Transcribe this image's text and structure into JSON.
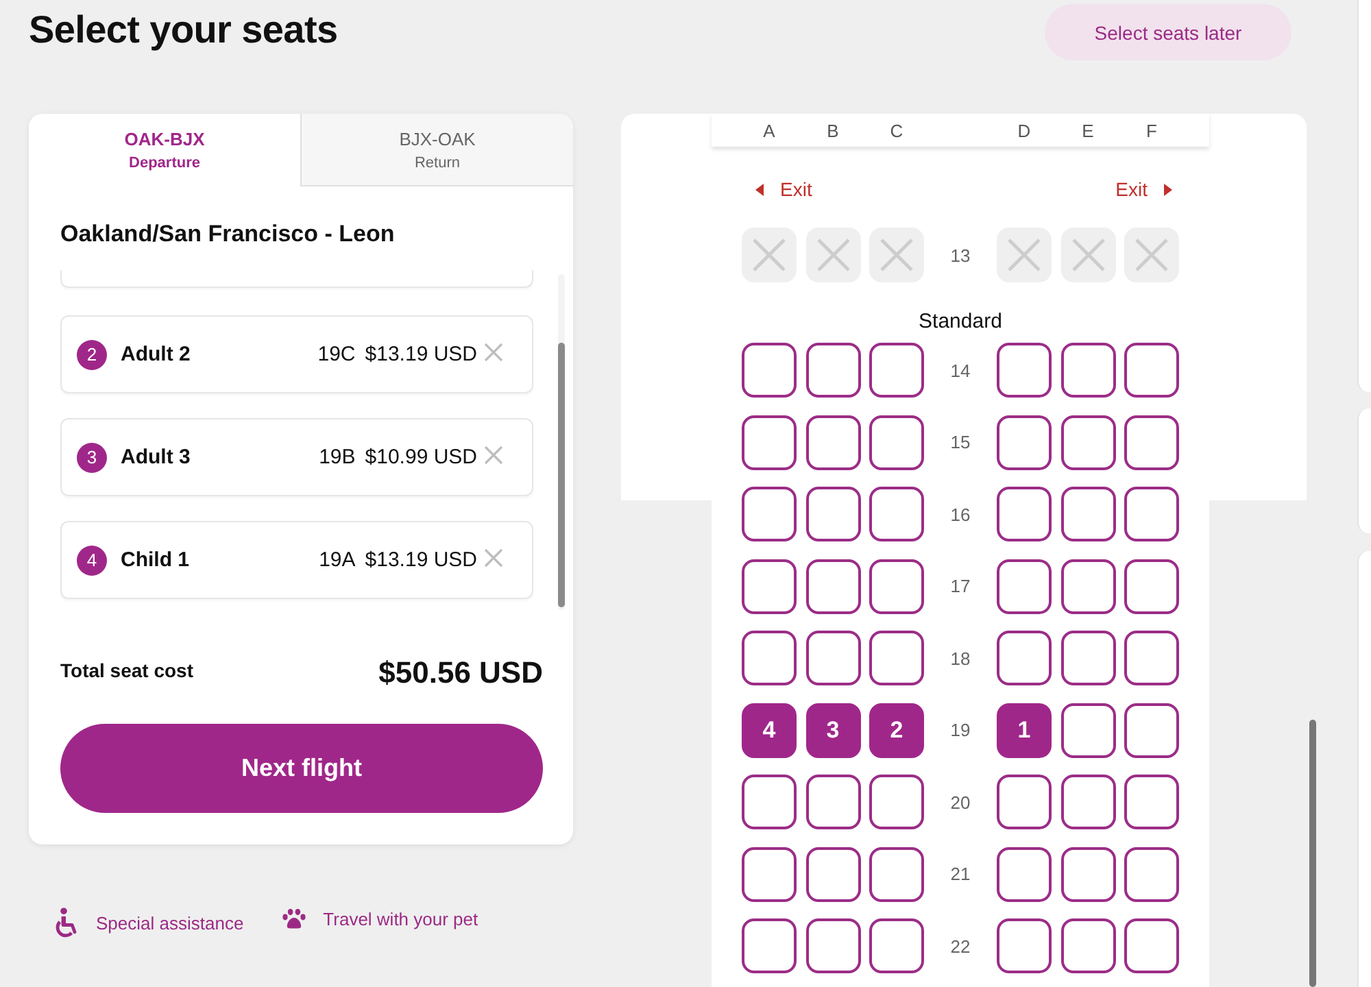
{
  "header": {
    "title": "Select your seats",
    "skip_button": "Select seats later"
  },
  "flight_tabs": [
    {
      "route": "OAK-BJX",
      "label": "Departure",
      "selected": true
    },
    {
      "route": "BJX-OAK",
      "label": "Return",
      "selected": false
    }
  ],
  "route_title": "Oakland/San Francisco - Leon",
  "passengers": [
    {
      "number": "2",
      "name": "Adult 2",
      "seat": "19C",
      "price": "$13.19 USD"
    },
    {
      "number": "3",
      "name": "Adult 3",
      "seat": "19B",
      "price": "$10.99 USD"
    },
    {
      "number": "4",
      "name": "Child 1",
      "seat": "19A",
      "price": "$13.19 USD"
    }
  ],
  "total": {
    "label": "Total seat cost",
    "value": "$50.56 USD"
  },
  "next_button": "Next flight",
  "links": [
    {
      "kind": "assistance",
      "label": "Special assistance"
    },
    {
      "kind": "pet",
      "label": "Travel with your pet"
    }
  ],
  "seat_map": {
    "column_groups": [
      [
        "A",
        "B",
        "C"
      ],
      [
        "D",
        "E",
        "F"
      ]
    ],
    "exits": [
      {
        "kind": "left",
        "label": "Exit"
      },
      {
        "kind": "right",
        "label": "Exit"
      }
    ],
    "rows": [
      {
        "kind": "seats",
        "number": "13",
        "seats": [
          {
            "selected": false,
            "disabled": true
          },
          {
            "selected": false,
            "disabled": true
          },
          {
            "selected": false,
            "disabled": true
          },
          {
            "selected": false,
            "disabled": true
          },
          {
            "selected": false,
            "disabled": true
          },
          {
            "selected": false,
            "disabled": true
          }
        ]
      },
      {
        "kind": "section",
        "label": "Standard"
      },
      {
        "kind": "seats",
        "number": "14",
        "seats": [
          {
            "selected": false,
            "disabled": false
          },
          {
            "selected": false,
            "disabled": false
          },
          {
            "selected": false,
            "disabled": false
          },
          {
            "selected": false,
            "disabled": false
          },
          {
            "selected": false,
            "disabled": false
          },
          {
            "selected": false,
            "disabled": false
          }
        ]
      },
      {
        "kind": "seats",
        "number": "15",
        "seats": [
          {
            "selected": false,
            "disabled": false
          },
          {
            "selected": false,
            "disabled": false
          },
          {
            "selected": false,
            "disabled": false
          },
          {
            "selected": false,
            "disabled": false
          },
          {
            "selected": false,
            "disabled": false
          },
          {
            "selected": false,
            "disabled": false
          }
        ]
      },
      {
        "kind": "seats",
        "number": "16",
        "seats": [
          {
            "selected": false,
            "disabled": false
          },
          {
            "selected": false,
            "disabled": false
          },
          {
            "selected": false,
            "disabled": false
          },
          {
            "selected": false,
            "disabled": false
          },
          {
            "selected": false,
            "disabled": false
          },
          {
            "selected": false,
            "disabled": false
          }
        ]
      },
      {
        "kind": "seats",
        "number": "17",
        "seats": [
          {
            "selected": false,
            "disabled": false
          },
          {
            "selected": false,
            "disabled": false
          },
          {
            "selected": false,
            "disabled": false
          },
          {
            "selected": false,
            "disabled": false
          },
          {
            "selected": false,
            "disabled": false
          },
          {
            "selected": false,
            "disabled": false
          }
        ]
      },
      {
        "kind": "seats",
        "number": "18",
        "seats": [
          {
            "selected": false,
            "disabled": false
          },
          {
            "selected": false,
            "disabled": false
          },
          {
            "selected": false,
            "disabled": false
          },
          {
            "selected": false,
            "disabled": false
          },
          {
            "selected": false,
            "disabled": false
          },
          {
            "selected": false,
            "disabled": false
          }
        ]
      },
      {
        "kind": "seats",
        "number": "19",
        "seats": [
          {
            "selected": true,
            "disabled": false,
            "label": "4"
          },
          {
            "selected": true,
            "disabled": false,
            "label": "3"
          },
          {
            "selected": true,
            "disabled": false,
            "label": "2"
          },
          {
            "selected": true,
            "disabled": false,
            "label": "1"
          },
          {
            "selected": false,
            "disabled": false
          },
          {
            "selected": false,
            "disabled": false
          }
        ]
      },
      {
        "kind": "seats",
        "number": "20",
        "seats": [
          {
            "selected": false,
            "disabled": false
          },
          {
            "selected": false,
            "disabled": false
          },
          {
            "selected": false,
            "disabled": false
          },
          {
            "selected": false,
            "disabled": false
          },
          {
            "selected": false,
            "disabled": false
          },
          {
            "selected": false,
            "disabled": false
          }
        ]
      },
      {
        "kind": "seats",
        "number": "21",
        "seats": [
          {
            "selected": false,
            "disabled": false
          },
          {
            "selected": false,
            "disabled": false
          },
          {
            "selected": false,
            "disabled": false
          },
          {
            "selected": false,
            "disabled": false
          },
          {
            "selected": false,
            "disabled": false
          },
          {
            "selected": false,
            "disabled": false
          }
        ]
      },
      {
        "kind": "seats",
        "number": "22",
        "seats": [
          {
            "selected": false,
            "disabled": false
          },
          {
            "selected": false,
            "disabled": false
          },
          {
            "selected": false,
            "disabled": false
          },
          {
            "selected": false,
            "disabled": false
          },
          {
            "selected": false,
            "disabled": false
          },
          {
            "selected": false,
            "disabled": false
          }
        ]
      }
    ]
  }
}
